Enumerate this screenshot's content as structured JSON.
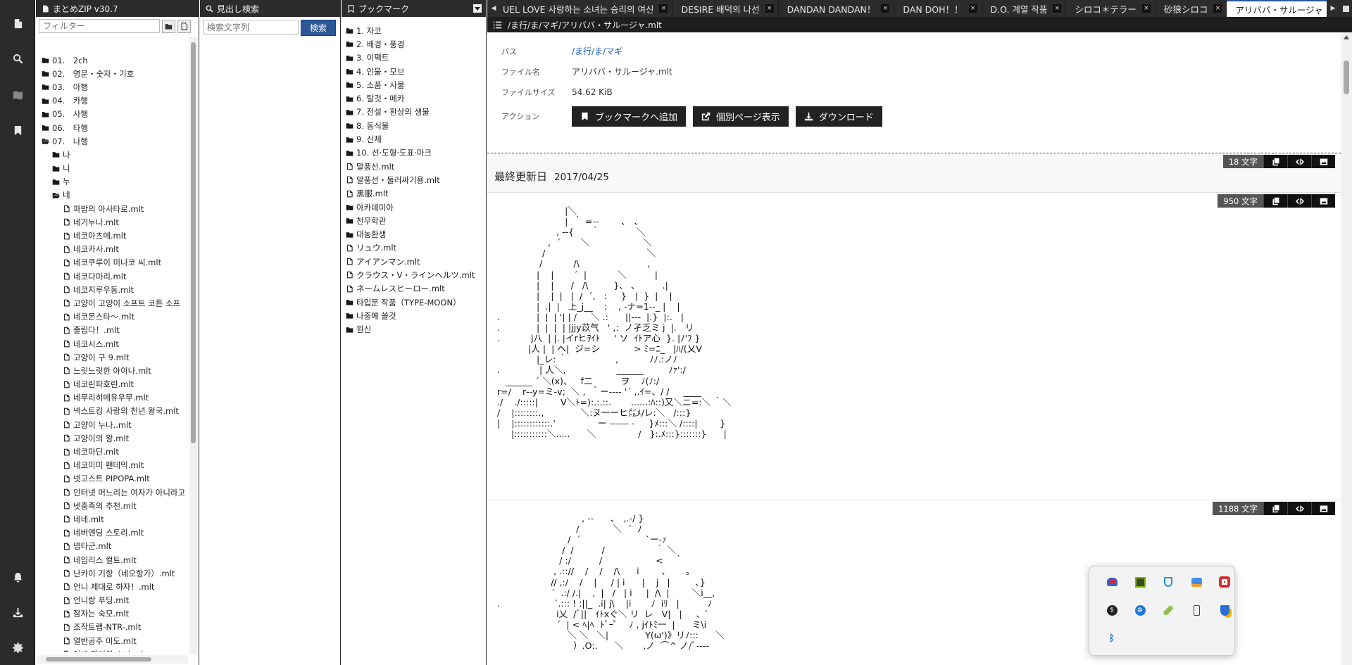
{
  "panes": {
    "tree_title": "まとめZIP v30.7",
    "search_title": "見出し検索",
    "bookmark_title": "ブックマーク"
  },
  "tree": {
    "filter_placeholder": "フィルター",
    "items": [
      {
        "label": "01.　2ch",
        "type": "folder",
        "level": 0
      },
      {
        "label": "02.　영문・숫자・기호",
        "type": "folder",
        "level": 0
      },
      {
        "label": "03.　아행",
        "type": "folder",
        "level": 0
      },
      {
        "label": "04.　카행",
        "type": "folder",
        "level": 0
      },
      {
        "label": "05.　사행",
        "type": "folder",
        "level": 0
      },
      {
        "label": "06.　타행",
        "type": "folder",
        "level": 0
      },
      {
        "label": "07.　나행",
        "type": "folder-open",
        "level": 0
      },
      {
        "label": "나",
        "type": "folder",
        "level": 1
      },
      {
        "label": "니",
        "type": "folder",
        "level": 1
      },
      {
        "label": "누",
        "type": "folder",
        "level": 1
      },
      {
        "label": "네",
        "type": "folder-open",
        "level": 1
      },
      {
        "label": "파밥의 아사타로.mlt",
        "type": "file",
        "level": 2
      },
      {
        "label": "네기누나.mlt",
        "type": "file",
        "level": 2
      },
      {
        "label": "네코아츠메.mlt",
        "type": "file",
        "level": 2
      },
      {
        "label": "네코카사.mlt",
        "type": "file",
        "level": 2
      },
      {
        "label": "네코쿠루이 미나코 씨.mlt",
        "type": "file",
        "level": 2
      },
      {
        "label": "네코다마리.mlt",
        "type": "file",
        "level": 2
      },
      {
        "label": "네코지루우동.mlt",
        "type": "file",
        "level": 2
      },
      {
        "label": "고양이 고양이 소프트 코튼 소프",
        "type": "file",
        "level": 2
      },
      {
        "label": "네코몬스타～.mlt",
        "type": "file",
        "level": 2
      },
      {
        "label": "졸립다！.mlt",
        "type": "file",
        "level": 2
      },
      {
        "label": "네코시스.mlt",
        "type": "file",
        "level": 2
      },
      {
        "label": "고양이 구 9.mlt",
        "type": "file",
        "level": 2
      },
      {
        "label": "느릿느릿한 아이나.mlt",
        "type": "file",
        "level": 2
      },
      {
        "label": "네코린파호린.mlt",
        "type": "file",
        "level": 2
      },
      {
        "label": "네무리히메유우무.mlt",
        "type": "file",
        "level": 2
      },
      {
        "label": "넥스트킹 사랑의 천년 왕국.mlt",
        "type": "file",
        "level": 2
      },
      {
        "label": "고양이 누나..mlt",
        "type": "file",
        "level": 2
      },
      {
        "label": "고양이의 왕.mlt",
        "type": "file",
        "level": 2
      },
      {
        "label": "네코마딘.mlt",
        "type": "file",
        "level": 2
      },
      {
        "label": "네코미미 팬데믹.mlt",
        "type": "file",
        "level": 2
      },
      {
        "label": "넷고스트 PIPOPA.mlt",
        "type": "file",
        "level": 2
      },
      {
        "label": "인터넷 머느리는 여자가 아니라고",
        "type": "file",
        "level": 2
      },
      {
        "label": "넷충족의 추천.mlt",
        "type": "file",
        "level": 2
      },
      {
        "label": "네네.mlt",
        "type": "file",
        "level": 2
      },
      {
        "label": "네버엔딩 스토리.mlt",
        "type": "file",
        "level": 2
      },
      {
        "label": "넵타군.mlt",
        "type": "file",
        "level": 2
      },
      {
        "label": "네임리스 컬트.mlt",
        "type": "file",
        "level": 2
      },
      {
        "label": "난카이 기항（네오항가）.mlt",
        "type": "file",
        "level": 2
      },
      {
        "label": "언니 제대로 하자！.mlt",
        "type": "file",
        "level": 2
      },
      {
        "label": "언니랑 푸딩.mlt",
        "type": "file",
        "level": 2
      },
      {
        "label": "잠자는 숙모.mlt",
        "type": "file",
        "level": 2
      },
      {
        "label": "조작트랩-NTR-.mlt",
        "type": "file",
        "level": 2
      },
      {
        "label": "열반공주 미도.mlt",
        "type": "file",
        "level": 2
      },
      {
        "label": "염대 적기의 소녀.mlt",
        "type": "file",
        "level": 2
      }
    ]
  },
  "search": {
    "placeholder": "検索文字列",
    "button": "検索"
  },
  "bookmarks": {
    "items": [
      {
        "label": "1. 자코",
        "type": "folder"
      },
      {
        "label": "2. 배경・풍경",
        "type": "folder"
      },
      {
        "label": "3. 이펙트",
        "type": "folder"
      },
      {
        "label": "4. 인물・모브",
        "type": "folder"
      },
      {
        "label": "5. 소품・사물",
        "type": "folder"
      },
      {
        "label": "6. 탈것・메카",
        "type": "folder"
      },
      {
        "label": "7. 전설・환상의 생물",
        "type": "folder"
      },
      {
        "label": "8. 동식물",
        "type": "folder"
      },
      {
        "label": "9. 신체",
        "type": "folder"
      },
      {
        "label": "10. 선·도형·도표·마크",
        "type": "folder"
      },
      {
        "label": "말풍선.mlt",
        "type": "file"
      },
      {
        "label": "말풍선・둘러싸기용.mlt",
        "type": "file"
      },
      {
        "label": "黒服.mlt",
        "type": "file"
      },
      {
        "label": "아카데미아",
        "type": "folder"
      },
      {
        "label": "천무학관",
        "type": "folder"
      },
      {
        "label": "대농환생",
        "type": "folder"
      },
      {
        "label": "リュウ.mlt",
        "type": "file"
      },
      {
        "label": "アイアンマン.mlt",
        "type": "file"
      },
      {
        "label": "クラウス・V・ラインヘルツ.mlt",
        "type": "file"
      },
      {
        "label": "ネームレスヒーロー.mlt",
        "type": "file"
      },
      {
        "label": "타입문 작품（TYPE-MOON）",
        "type": "folder"
      },
      {
        "label": "나중에 쓸것",
        "type": "folder"
      },
      {
        "label": "원신",
        "type": "folder"
      }
    ]
  },
  "tabs": [
    {
      "label": "UEL LOVE 사랑하는 소녀는 승리의 여신",
      "active": false
    },
    {
      "label": "DESIRE 배덕의 나선",
      "active": false
    },
    {
      "label": "DANDAN DANDAN！",
      "active": false
    },
    {
      "label": "DAN DOH！！",
      "active": false
    },
    {
      "label": "D.O. 계열 작품",
      "active": false
    },
    {
      "label": "シロコ＊テラー",
      "active": false
    },
    {
      "label": "砂狼シロコ",
      "active": false
    },
    {
      "label": "アリババ・サルージャ",
      "active": true
    }
  ],
  "path": "/ま行/ま/マギ/アリババ・サルージャ.mlt",
  "file_info": {
    "path_label": "パス",
    "path_value": "/ま行/ま/マギ",
    "name_label": "ファイル名",
    "name_value": "アリババ・サルージャ.mlt",
    "size_label": "ファイルサイズ",
    "size_value": "54.62 KiB",
    "action_label": "アクション",
    "btn_bookmark": "ブックマークへ追加",
    "btn_page": "個別ページ表示",
    "btn_download": "ダウンロード"
  },
  "sections": [
    {
      "count": "18 文字",
      "label": "最終更新日",
      "date": "2017/04/25"
    },
    {
      "count": "950 文字",
      "art": "                         |＼\n                         |  ｀ =--        ､   ､\n                      , --{      ｀             ＼\n                   ,  ´       ＼                   ＼\n                 /                                    ＼\n                /           /\\                        ,\n               |    |       ´  |           ＼          |\n               |    |      /   /\\         }、 、        .|\n               |    |  |   |  /  ´,   :     }   |  }  |    |\n               |  .|  |   上_j__    :    , -ナ=1--_ |    |\n .             |  |  | '| | /     ＼ .:      ||---  |.}  |:.   |\n .             |  |  |  | |jjy苡气   ' ,:  ノ孑乏ミ j  |.   リ\n .           j八  | |. |イrヒｦｲﾄ     ' ソ  ｲﾄア心  }. |ﾉ'ﾌ }\n            |人 |  | ヘ|  ジ=シ            > ﾐ=ﾆ_   |ﾊ/(乂V\n               |_レ: ｀                 ,           ﾉﾉ.:ノﾉ\n .              | 人＼,                  ______         ﾉｧ':/\n    ______ ´ ＼(x)、   f二          ヲ    ﾉ(ﾉ:/\n r=/    r‐‐y=ミ-v;  ＼ ,  ｀ー‐‐‐‐ '´ ,.ｲ=、/ /     ____\n ./    ./:::::|        V＼ﾄ=):.:.::.       ......:ﾊ::)又＼ニ=:＼ ｀＼\n /    |::::::::.,             ＼:ヌ一ーヒ㍍ﾒ/レ:＼   /:::}\n |    |::::::::::::.'               ー ------ -     }ﾒ:::＼ /::::|        }\n      |:::::::::::＼.....      ＼               /   }:.ﾒ:::}:::::::}      |"
    },
    {
      "count": "1188 文字",
      "art": "                               , --      ､   ,.-/ }\n                             /            ＼  ´  ﾉ\n                          /  ´                       `ー-ｧ\n                        /  /          /                  ｀ ＼\n                       / :/          /                   <    ｀\n                     , .:://    /    /    /\\      i        ､       。\n                    // ,:/    /    |     / | i      |    j   |         ､}\n                    ´  .:/ /.|    ,  |   /   | i     |  /\\  |        ＼i__,\n .                   ´.::: ! :||_  .i| j\\    |i       ﾉ  iﾘ   |          ﾉ\n                      i乂  /ﾞ||   ｲﾄxぐ＼ リ  レ   V|   |     ､ ´\n                      ´  | < ﾍ|ﾍ  ﾄﾞｰﾟ    ﾉ , jｲﾄﾐ一  |      ミ\\i\n                          ＼ ＼   ＼|             Y(ω')》リﾉ:::      ＼\n                            ）.O:.      ＼       ,ノ  ⌒^ ノ/ﾞ‐‐‐‐ "
    }
  ],
  "tray": {
    "icons": [
      "creative-cloud",
      "nvidia",
      "defender",
      "windows-security",
      "red-app",
      "dollar-app",
      "snowflake-app",
      "pill-app",
      "usb-drive",
      "security-warning",
      "bluetooth"
    ]
  },
  "colors": {
    "header_bg": "#2c2c2c",
    "accent": "#2b5797",
    "action_btn": "#222222"
  }
}
